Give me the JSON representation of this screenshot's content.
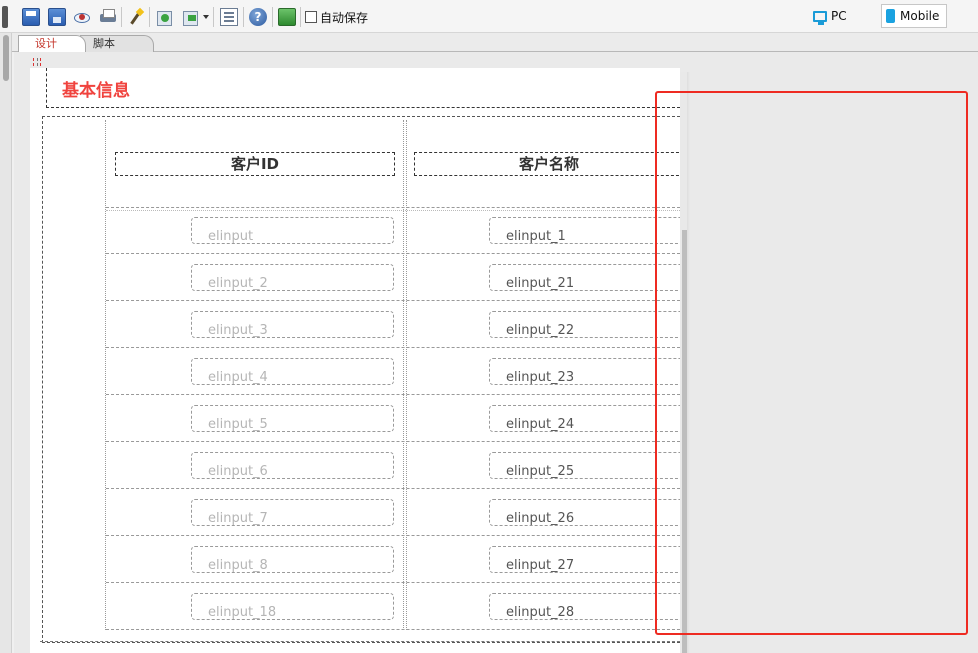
{
  "toolbar": {
    "buttons": [
      "save-icon",
      "save-as-icon",
      "preview-icon",
      "print-icon",
      "magic-wand-icon",
      "import-icon",
      "export-icon",
      "list-icon",
      "help-icon",
      "green-block-icon"
    ],
    "autosave_label": "自动保存",
    "autosave_checked": false,
    "view_pc_label": "PC",
    "view_mobile_label": "Mobile",
    "active_view": "Mobile"
  },
  "tabs": [
    {
      "label": "设计",
      "active": true
    },
    {
      "label": "脚本",
      "active": false
    }
  ],
  "form": {
    "section_title": "基本信息",
    "section_title_color": "#f0433e",
    "columns": [
      {
        "label": "客户ID"
      },
      {
        "label": "客户名称"
      }
    ],
    "rows": [
      {
        "left": "elinput",
        "right": "elinput_1"
      },
      {
        "left": "elinput_2",
        "right": "elinput_21"
      },
      {
        "left": "elinput_3",
        "right": "elinput_22"
      },
      {
        "left": "elinput_4",
        "right": "elinput_23"
      },
      {
        "left": "elinput_5",
        "right": "elinput_24"
      },
      {
        "left": "elinput_6",
        "right": "elinput_25"
      },
      {
        "left": "elinput_7",
        "right": "elinput_26"
      },
      {
        "left": "elinput_8",
        "right": "elinput_27"
      },
      {
        "left": "elinput_18",
        "right": "elinput_28"
      }
    ]
  },
  "highlight_color": "#ee2b22"
}
